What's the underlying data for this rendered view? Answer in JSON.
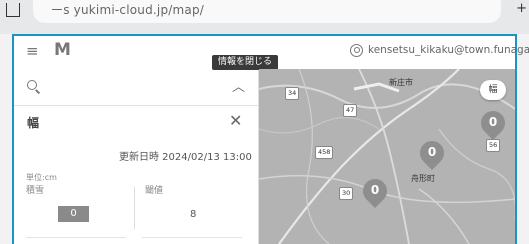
{
  "browser": {
    "url": "ーs yukimi-cloud.jp/map/"
  },
  "header": {
    "logo": "M",
    "account_email": "kensetsu_kikaku@town.funagata.y"
  },
  "tooltip": {
    "text": "情報を閉じる"
  },
  "panel": {
    "title": "幅",
    "updated": "更新日時 2024/02/13 13:00",
    "unit": "単位:cm",
    "columns": [
      {
        "header": "積雪",
        "value": "0"
      },
      {
        "header": "閾値",
        "value": "8"
      }
    ]
  },
  "map": {
    "layer_button": "幅",
    "place_labels": [
      "新庄市",
      "舟形町"
    ],
    "route_numbers": [
      "34",
      "47",
      "458",
      "30",
      "56"
    ],
    "markers": [
      {
        "value": "0"
      },
      {
        "value": "0"
      },
      {
        "value": "0"
      }
    ]
  },
  "icons": [
    "menu-icon",
    "account-icon",
    "search-icon",
    "chevron-up-icon",
    "close-icon",
    "map-marker-icon"
  ]
}
